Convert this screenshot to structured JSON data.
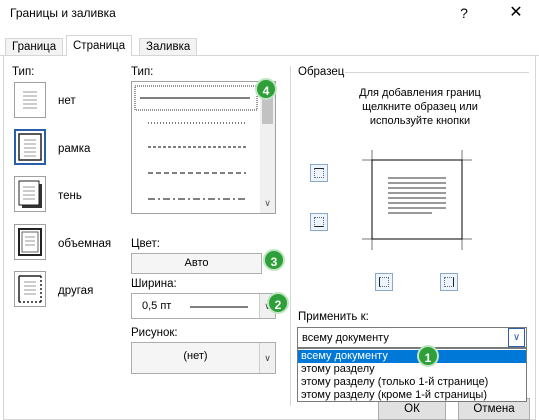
{
  "window": {
    "title": "Границы и заливка",
    "help_glyph": "?",
    "close_glyph": "✕"
  },
  "tabs": [
    {
      "label": "Граница"
    },
    {
      "label": "Страница"
    },
    {
      "label": "Заливка"
    }
  ],
  "settings": {
    "label": "Тип:",
    "items": [
      {
        "label": "нет",
        "icon": "none-setting-icon"
      },
      {
        "label": "рамка",
        "icon": "box-setting-icon"
      },
      {
        "label": "тень",
        "icon": "shadow-setting-icon"
      },
      {
        "label": "объемная",
        "icon": "3d-setting-icon"
      },
      {
        "label": "другая",
        "icon": "custom-setting-icon"
      }
    ]
  },
  "style": {
    "label": "Тип:",
    "items": [
      "solid",
      "dotted",
      "dashed-small",
      "dashed",
      "dash-dot"
    ],
    "selected_index": 0
  },
  "color": {
    "label": "Цвет:",
    "value": "Авто"
  },
  "width": {
    "label": "Ширина:",
    "value": "0,5 пт"
  },
  "art": {
    "label": "Рисунок:",
    "value": "(нет)"
  },
  "preview": {
    "title": "Образец",
    "description_lines": [
      "Для добавления границ",
      "щелкните образец или",
      "используйте кнопки"
    ]
  },
  "apply_to": {
    "label": "Применить к:",
    "value": "всему документу",
    "options": [
      "всему документу",
      "этому разделу",
      "этому разделу (только 1-й странице)",
      "этому разделу (кроме 1-й страницы)"
    ],
    "selected_index": 0
  },
  "buttons": {
    "ok": "ОК",
    "cancel": "Отмена"
  },
  "badges": [
    "1",
    "2",
    "3",
    "4"
  ],
  "colors": {
    "accent": "#2a5ea8",
    "selection": "#0078d7",
    "badge": "#2f9f3a"
  }
}
